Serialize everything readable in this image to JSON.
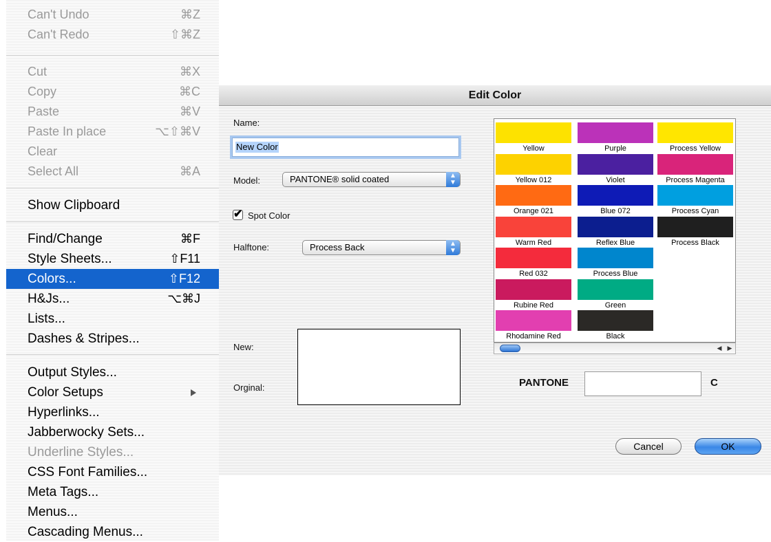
{
  "menu": {
    "items": [
      {
        "label": "Can't Undo",
        "shortcut": "⌘Z",
        "disabled": true
      },
      {
        "label": "Can't Redo",
        "shortcut": "⇧⌘Z",
        "disabled": true
      },
      {
        "label": "Cut",
        "shortcut": "⌘X",
        "disabled": true
      },
      {
        "label": "Copy",
        "shortcut": "⌘C",
        "disabled": true
      },
      {
        "label": "Paste",
        "shortcut": "⌘V",
        "disabled": true
      },
      {
        "label": "Paste In place",
        "shortcut": "⌥⇧⌘V",
        "disabled": true
      },
      {
        "label": "Clear",
        "shortcut": "",
        "disabled": true
      },
      {
        "label": "Select All",
        "shortcut": "⌘A",
        "disabled": true
      },
      {
        "label": "Show Clipboard",
        "shortcut": ""
      },
      {
        "label": "Find/Change",
        "shortcut": "⌘F"
      },
      {
        "label": "Style Sheets...",
        "shortcut": "⇧F11"
      },
      {
        "label": "Colors...",
        "shortcut": "⇧F12",
        "selected": true
      },
      {
        "label": "H&Js...",
        "shortcut": "⌥⌘J"
      },
      {
        "label": "Lists...",
        "shortcut": ""
      },
      {
        "label": "Dashes & Stripes...",
        "shortcut": ""
      },
      {
        "label": "Output Styles...",
        "shortcut": ""
      },
      {
        "label": "Color Setups",
        "shortcut": "",
        "submenu": true
      },
      {
        "label": "Hyperlinks...",
        "shortcut": ""
      },
      {
        "label": "Jabberwocky Sets...",
        "shortcut": ""
      },
      {
        "label": "Underline Styles...",
        "shortcut": "",
        "disabled": true
      },
      {
        "label": "CSS Font Families...",
        "shortcut": ""
      },
      {
        "label": "Meta Tags...",
        "shortcut": ""
      },
      {
        "label": "Menus...",
        "shortcut": ""
      },
      {
        "label": "Cascading Menus...",
        "shortcut": ""
      }
    ]
  },
  "dialog": {
    "title": "Edit Color",
    "name_label": "Name:",
    "name_value": "New Color",
    "model_label": "Model:",
    "model_value": "PANTONE® solid coated",
    "spot_color_label": "Spot Color",
    "spot_color_checked": "✔",
    "halftone_label": "Halftone:",
    "halftone_value": "Process Back",
    "new_label": "New:",
    "original_label": "Orginal:",
    "pantone_label": "PANTONE",
    "pantone_suffix": "C",
    "cancel_label": "Cancel",
    "ok_label": "OK",
    "swatches": [
      {
        "name": "Yellow",
        "color": "#fde200"
      },
      {
        "name": "Purple",
        "color": "#bb32b9"
      },
      {
        "name": "Process Yellow",
        "color": "#ffe600"
      },
      {
        "name": "Yellow 012",
        "color": "#fdd200"
      },
      {
        "name": "Violet",
        "color": "#4b20a0"
      },
      {
        "name": "Process Magenta",
        "color": "#d9247a"
      },
      {
        "name": "Orange 021",
        "color": "#ff6a13"
      },
      {
        "name": "Blue 072",
        "color": "#0e1bb6"
      },
      {
        "name": "Process Cyan",
        "color": "#009fe0"
      },
      {
        "name": "Warm Red",
        "color": "#f9433a"
      },
      {
        "name": "Reflex Blue",
        "color": "#0c1e8f"
      },
      {
        "name": "Process Black",
        "color": "#1f1f1f"
      },
      {
        "name": "Red 032",
        "color": "#f42b3c"
      },
      {
        "name": "Process Blue",
        "color": "#0086cd"
      },
      {
        "name": "Rubine Red",
        "color": "#ca1a5e"
      },
      {
        "name": "Green",
        "color": "#00ab84"
      },
      {
        "name": "Rhodamine Red",
        "color": "#e23fb0"
      },
      {
        "name": "Black",
        "color": "#2b2926"
      }
    ]
  }
}
